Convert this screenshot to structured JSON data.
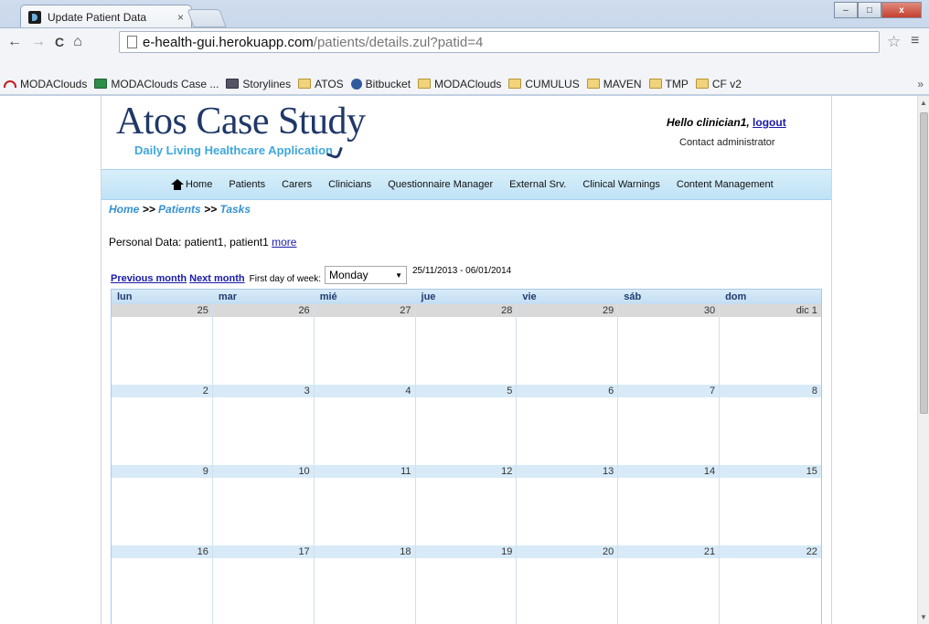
{
  "browser": {
    "tab_title": "Update Patient Data",
    "tab_close": "×",
    "window_controls": {
      "minimize": "–",
      "maximize": "□",
      "close": "x"
    },
    "nav": {
      "back": "←",
      "forward": "→",
      "reload": "C",
      "home": "⌂"
    },
    "url_host": "e-health-gui.herokuapp.com",
    "url_path": "/patients/details.zul?patid=4",
    "star": "☆",
    "menu": "≡",
    "bookmarks": [
      {
        "label": "MODAClouds",
        "icon": "cloud-icon"
      },
      {
        "label": "MODAClouds Case ...",
        "icon": "sheet-icon"
      },
      {
        "label": "Storylines",
        "icon": "story-icon"
      },
      {
        "label": "ATOS",
        "icon": "folder-icon"
      },
      {
        "label": "Bitbucket",
        "icon": "bucket-icon"
      },
      {
        "label": "MODAClouds",
        "icon": "folder-icon"
      },
      {
        "label": "CUMULUS",
        "icon": "folder-icon"
      },
      {
        "label": "MAVEN",
        "icon": "folder-icon"
      },
      {
        "label": "TMP",
        "icon": "folder-icon"
      },
      {
        "label": "CF v2",
        "icon": "folder-icon"
      }
    ],
    "bookmarks_more": "»"
  },
  "header": {
    "brand_title": "Atos Case Study",
    "brand_subtitle": "Daily Living Healthcare Application",
    "hello": "Hello clinician1,",
    "logout": "logout",
    "contact": "Contact administrator"
  },
  "nav_menu": [
    "Home",
    "Patients",
    "Carers",
    "Clinicians",
    "Questionnaire Manager",
    "External Srv.",
    "Clinical Warnings",
    "Content Management"
  ],
  "breadcrumb": {
    "home": "Home",
    "sep": ">>",
    "patients": "Patients",
    "tasks": "Tasks"
  },
  "personal": {
    "text": "Personal Data: patient1, patient1",
    "more": "more"
  },
  "calendar_controls": {
    "previous": "Previous month",
    "next": "Next month",
    "first_day_label": "First day of week:",
    "first_day_value": "Monday",
    "date_range": "25/11/2013 - 06/01/2014"
  },
  "calendar": {
    "weekdays": [
      "lun",
      "mar",
      "mié",
      "jue",
      "vie",
      "sáb",
      "dom"
    ],
    "weeks": [
      [
        "25",
        "26",
        "27",
        "28",
        "29",
        "30",
        "dic 1"
      ],
      [
        "2",
        "3",
        "4",
        "5",
        "6",
        "7",
        "8"
      ],
      [
        "9",
        "10",
        "11",
        "12",
        "13",
        "14",
        "15"
      ],
      [
        "16",
        "17",
        "18",
        "19",
        "20",
        "21",
        "22"
      ]
    ]
  }
}
